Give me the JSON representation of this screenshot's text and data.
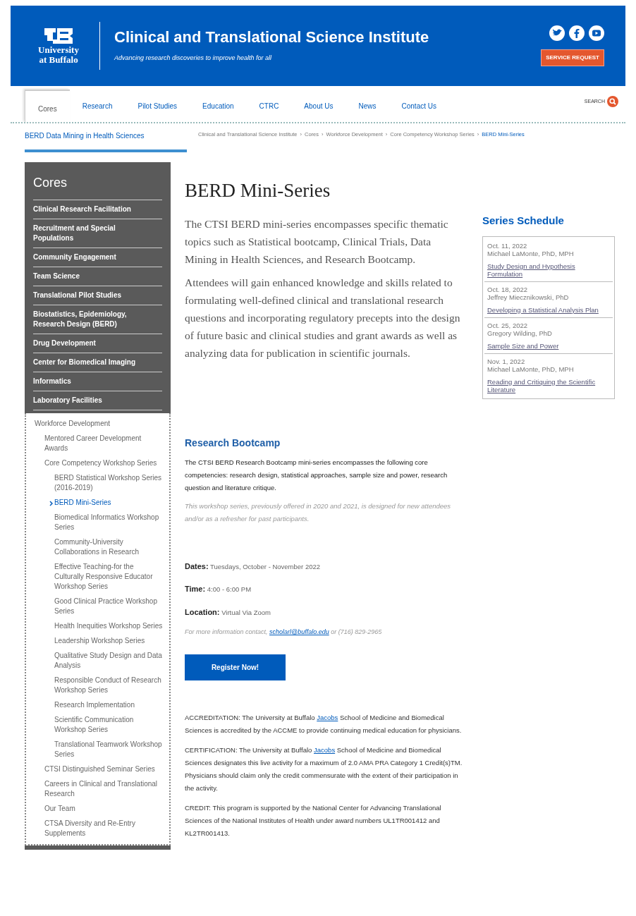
{
  "header": {
    "logo_lines": [
      "University",
      "at Buffalo"
    ],
    "title": "Clinical and Translational Science Institute",
    "tagline": "Advancing research discoveries to improve health for all",
    "service_button": "SERVICE REQUEST"
  },
  "nav": {
    "items": [
      {
        "label": "Cores",
        "selected": true
      },
      {
        "label": "Research",
        "selected": false
      },
      {
        "label": "Pilot Studies",
        "selected": false
      },
      {
        "label": "Education",
        "selected": false
      },
      {
        "label": "CTRC",
        "selected": false
      },
      {
        "label": "About Us",
        "selected": false
      },
      {
        "label": "News",
        "selected": false
      },
      {
        "label": "Contact Us",
        "selected": false
      }
    ],
    "search_label": "SEARCH"
  },
  "subnav": {
    "title": "BERD Data Mining in Health Sciences",
    "separator": "›",
    "breadcrumb": [
      "Clinical and Translational Science Institute",
      "Cores",
      "Workforce Development",
      "Core Competency Workshop Series",
      "BERD Mini-Series"
    ]
  },
  "sidebar": {
    "title": "Cores",
    "items": [
      "Clinical Research Facilitation",
      "Recruitment and Special Populations",
      "Community Engagement",
      "Team Science",
      "Translational Pilot Studies",
      "Biostatistics, Epidemiology, Research Design (BERD)",
      "Drug Development",
      "Center for Biomedical Imaging",
      "Informatics",
      "Laboratory Facilities"
    ],
    "tree": [
      {
        "label": "Workforce Development",
        "selected": false,
        "children": [
          {
            "label": "Mentored Career Development Awards",
            "selected": false
          },
          {
            "label": "Core Competency Workshop Series",
            "selected": false,
            "children": [
              {
                "label": "BERD Statistical Workshop Series (2016-2019)",
                "selected": false
              },
              {
                "label": "BERD Mini-Series",
                "selected": true
              },
              {
                "label": "Biomedical Informatics Workshop Series",
                "selected": false
              },
              {
                "label": "Community-University Collaborations in Research",
                "selected": false
              },
              {
                "label": "Effective Teaching-for the Culturally Responsive Educator Workshop Series",
                "selected": false
              },
              {
                "label": "Good Clinical Practice Workshop Series",
                "selected": false
              },
              {
                "label": "Health Inequities Workshop Series",
                "selected": false
              },
              {
                "label": "Leadership Workshop Series",
                "selected": false
              },
              {
                "label": "Qualitative Study Design and Data Analysis",
                "selected": false
              },
              {
                "label": "Responsible Conduct of Research Workshop Series",
                "selected": false
              },
              {
                "label": "Research Implementation",
                "selected": false
              },
              {
                "label": "Scientific Communication Workshop Series",
                "selected": false
              },
              {
                "label": "Translational Teamwork Workshop Series",
                "selected": false
              }
            ]
          },
          {
            "label": "CTSI Distinguished Seminar Series",
            "selected": false
          },
          {
            "label": "Careers in Clinical and Translational Research",
            "selected": false
          },
          {
            "label": "Our Team",
            "selected": false
          },
          {
            "label": "CTSA Diversity and Re-Entry Supplements",
            "selected": false
          }
        ]
      }
    ]
  },
  "main": {
    "title": "BERD Mini-Series",
    "intro": [
      "The CTSI BERD mini-series encompasses specific thematic topics such as Statistical bootcamp, Clinical Trials, Data Mining in Health Sciences, and Research Bootcamp.",
      "Attendees will gain enhanced knowledge and skills related to formulating well-defined clinical and translational research questions and incorporating regulatory precepts into the design of future basic and clinical studies and grant awards as well as analyzing data for publication in scientific journals."
    ],
    "section_title": "Research Bootcamp",
    "section_text": "The CTSI BERD Research Bootcamp mini-series encompasses the following core competencies: research design, statistical approaches, sample size and power, research question and literature critique.",
    "note": "This workshop series, previously offered in 2020 and 2021, is designed for new attendees and/or as a refresher for past participants.",
    "details": [
      {
        "label": "Dates:",
        "value": "Tuesdays, October - November 2022"
      },
      {
        "label": "Time:",
        "value": "4:00 - 6:00 PM"
      },
      {
        "label": "Location:",
        "value": "Virtual Via Zoom"
      }
    ],
    "contact": {
      "before": "For more information contact, ",
      "link": "scholarl@buffalo.edu",
      "after": " or (716) 829-2965"
    },
    "register_button": "Register Now!",
    "statements": [
      {
        "before": "ACCREDITATION: The University at Buffalo ",
        "link": "Jacobs",
        "after": " School of Medicine and Biomedical Sciences is accredited by the ACCME to provide continuing medical education for physicians."
      },
      {
        "before": "CERTIFICATION: The University at Buffalo ",
        "link": "Jacobs",
        "after": " School of Medicine and Biomedical Sciences designates this live activity for a maximum of 2.0 AMA PRA Category 1 Credit(s)TM.  Physicians should claim only the credit commensurate with the extent of their participation in the activity."
      },
      {
        "before": "CREDIT: This program is supported by the National Center for Advancing Translational Sciences of the National Institutes of Health under award numbers UL1TR001412 and KL2TR001413."
      }
    ]
  },
  "schedule": {
    "title": "Series Schedule",
    "items": [
      {
        "date": "Oct. 11, 2022",
        "speaker": "Michael LaMonte, PhD, MPH",
        "topic": "Study Design and Hypothesis Formulation"
      },
      {
        "date": "Oct. 18, 2022",
        "speaker": "Jeffrey Miecznikowski, PhD",
        "topic": "Developing a Statistical Analysis Plan"
      },
      {
        "date": "Oct. 25, 2022",
        "speaker": "Gregory Wilding, PhD",
        "topic": "Sample Size and Power"
      },
      {
        "date": "Nov. 1, 2022",
        "speaker": "Michael LaMonte, PhD, MPH",
        "topic": "Reading and Critiquing the Scientific Literature"
      }
    ]
  }
}
